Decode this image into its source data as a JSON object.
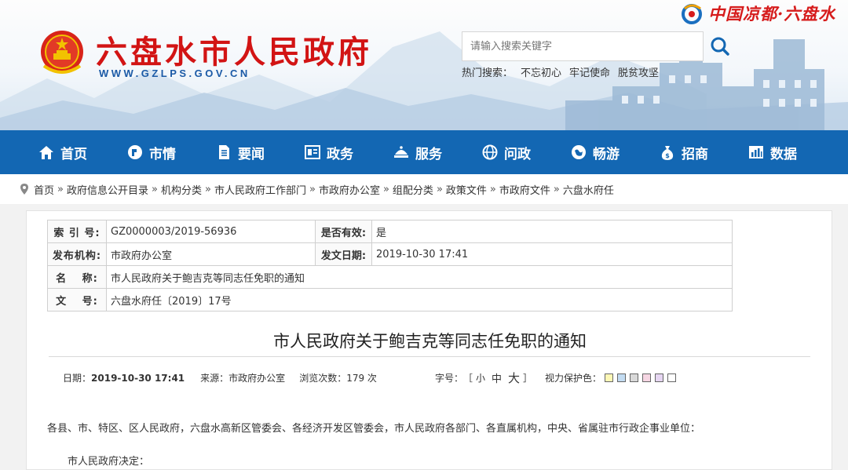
{
  "header": {
    "site_title": "六盘水市人民政府",
    "site_url": "WWW.GZLPS.GOV.CN",
    "slogan": "中国凉都·六盘水",
    "search_placeholder": "请输入搜索关键字",
    "hot_label": "热门搜索：",
    "hot_terms": [
      "不忘初心",
      "牢记使命",
      "脱贫攻坚"
    ]
  },
  "nav": [
    {
      "label": "首页",
      "icon": "home-icon"
    },
    {
      "label": "市情",
      "icon": "city-icon"
    },
    {
      "label": "要闻",
      "icon": "news-icon"
    },
    {
      "label": "政务",
      "icon": "government-icon"
    },
    {
      "label": "服务",
      "icon": "service-icon"
    },
    {
      "label": "问政",
      "icon": "globe-icon"
    },
    {
      "label": "畅游",
      "icon": "travel-icon"
    },
    {
      "label": "招商",
      "icon": "investment-icon"
    },
    {
      "label": "数据",
      "icon": "data-icon"
    }
  ],
  "breadcrumb": [
    "首页",
    "政府信息公开目录",
    "机构分类",
    "市人民政府工作部门",
    "市政府办公室",
    "组配分类",
    "政策文件",
    "市政府文件",
    "六盘水府任"
  ],
  "meta": {
    "index_label": "索 引 号:",
    "index_value": "GZ0000003/2019-56936",
    "valid_label": "是否有效:",
    "valid_value": "是",
    "org_label": "发布机构:",
    "org_value": "市政府办公室",
    "date_label": "发文日期:",
    "date_value": "2019-10-30 17:41",
    "name_label": "名　 称:",
    "name_value": "市人民政府关于鲍吉克等同志任免职的通知",
    "docno_label": "文　 号:",
    "docno_value": "六盘水府任〔2019〕17号"
  },
  "document": {
    "title": "市人民政府关于鲍吉克等同志任免职的通知",
    "date_label": "日期：",
    "date_value": "2019-10-30 17:41",
    "source_label": "来源：",
    "source_value": "市政府办公室",
    "views_label": "浏览次数：",
    "views_value": "179 次",
    "font_label": "字号：",
    "font_open": "［",
    "font_small": "小",
    "font_medium": "中",
    "font_large": "大",
    "font_close": "］",
    "eye_label": "视力保护色：",
    "eye_colors": [
      "#fdf7b5",
      "#c3dcf2",
      "#d9d9d9",
      "#f6d6e3",
      "#e6d6f2",
      "#ffffff"
    ],
    "para1": "各县、市、特区、区人民政府，六盘水高新区管委会、各经济开发区管委会，市人民政府各部门、各直属机构，中央、省属驻市行政企事业单位：",
    "para2": "市人民政府决定："
  },
  "colors": {
    "nav_bg": "#1367b3",
    "title_red": "#d21414",
    "url_blue": "#1b5aa6"
  }
}
